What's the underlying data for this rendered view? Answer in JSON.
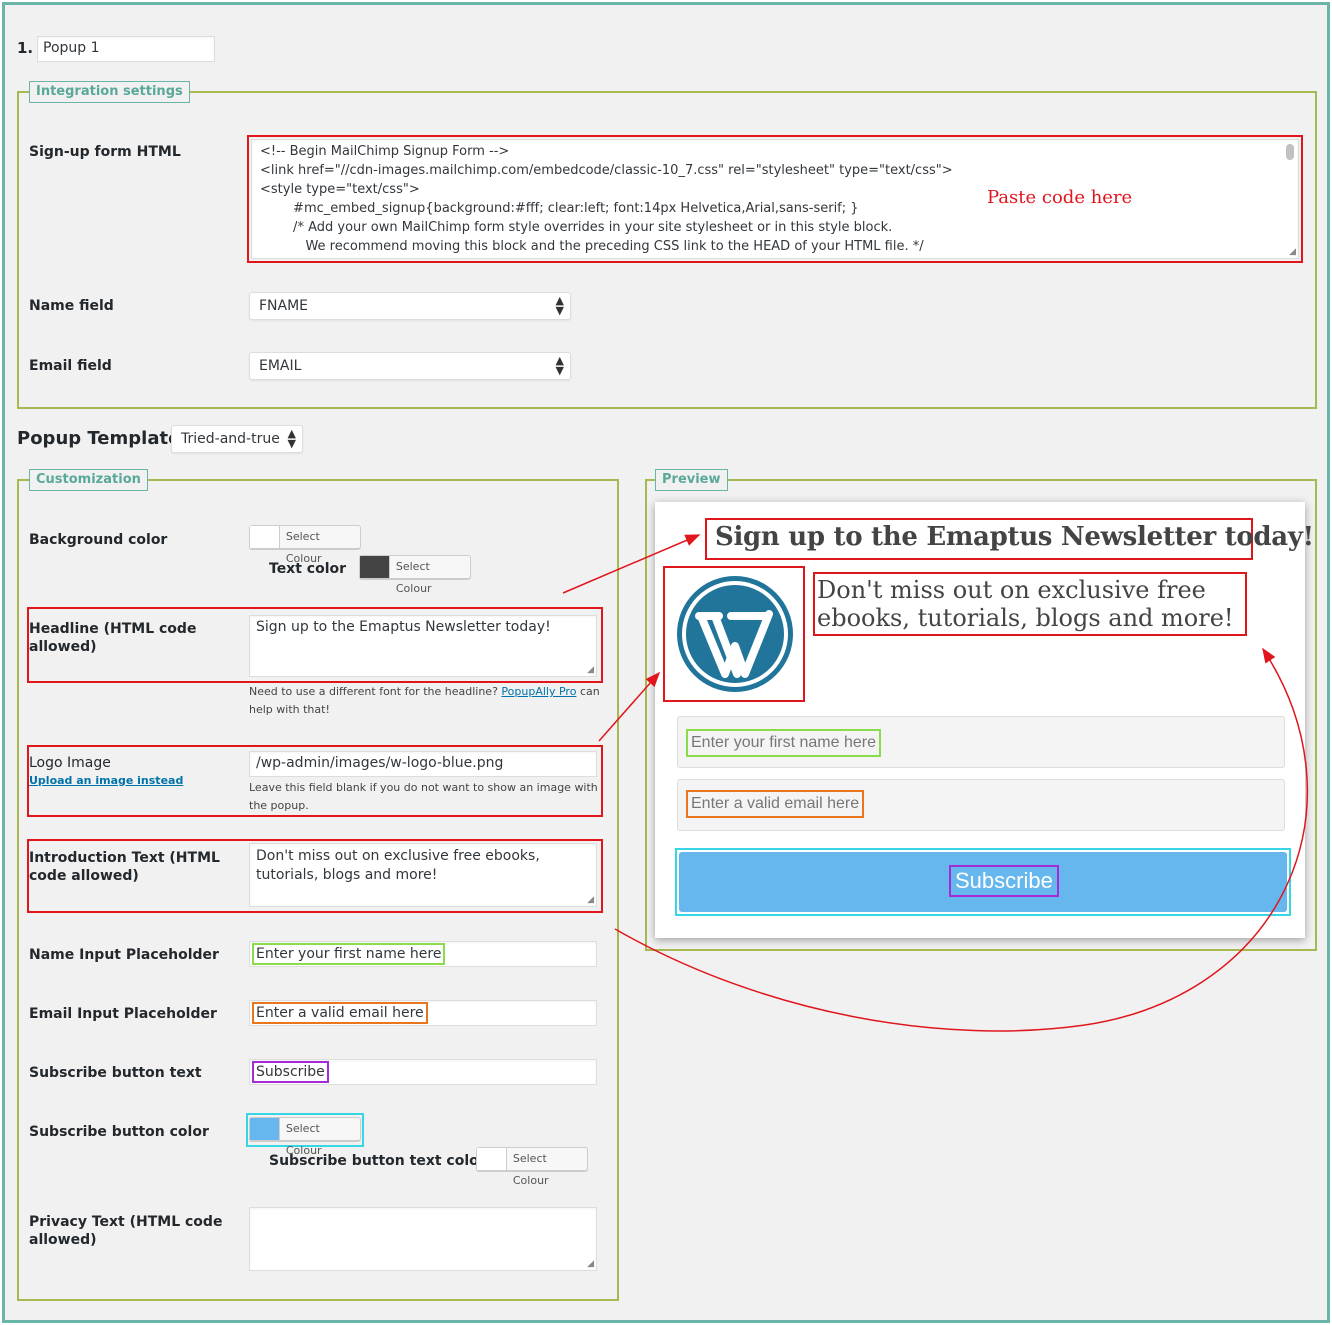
{
  "popup": {
    "number": "1.",
    "name": "Popup 1"
  },
  "integration": {
    "legend": "Integration settings",
    "signup_label": "Sign-up form HTML",
    "code_lines": [
      "<!-- Begin MailChimp Signup Form -->",
      "<link href=\"//cdn-images.mailchimp.com/embedcode/classic-10_7.css\" rel=\"stylesheet\" type=\"text/css\">",
      "<style type=\"text/css\">",
      "        #mc_embed_signup{background:#fff; clear:left; font:14px Helvetica,Arial,sans-serif; }",
      "        /* Add your own MailChimp form style overrides in your site stylesheet or in this style block.",
      "           We recommend moving this block and the preceding CSS link to the HEAD of your HTML file. */"
    ],
    "paste_note": "Paste code here",
    "name_label": "Name field",
    "name_value": "FNAME",
    "email_label": "Email field",
    "email_value": "EMAIL"
  },
  "template": {
    "label": "Popup Template",
    "value": "Tried-and-true"
  },
  "customization": {
    "legend": "Customization",
    "bg_label": "Background color",
    "select_colour": "Select Colour",
    "text_color_label": "Text color",
    "headline_label": "Headline (HTML code allowed)",
    "headline_value": "Sign up to the Emaptus Newsletter today!",
    "headline_help_pre": "Need to use a different font for the headline?",
    "headline_help_link": "PopupAlly Pro",
    "headline_help_post": "can help with that!",
    "logo_label": "Logo Image",
    "logo_upload": "Upload an image instead",
    "logo_value": "/wp-admin/images/w-logo-blue.png",
    "logo_help": "Leave this field blank if you do not want to show an image with the popup.",
    "intro_label": "Introduction Text (HTML code allowed)",
    "intro_value": "Don't miss out on exclusive free ebooks, tutorials, blogs and more!",
    "name_ph_label": "Name Input Placeholder",
    "name_ph_value": "Enter your first name here",
    "email_ph_label": "Email Input Placeholder",
    "email_ph_value": "Enter a valid email here",
    "btn_text_label": "Subscribe button text",
    "btn_text_value": "Subscribe",
    "btn_color_label": "Subscribe button color",
    "btn_text_color_label": "Subscribe button text color",
    "privacy_label": "Privacy Text (HTML code allowed)",
    "privacy_value": ""
  },
  "preview": {
    "legend": "Preview",
    "headline": "Sign up to the Emaptus Newsletter today!",
    "intro": "Don't miss out on exclusive free ebooks, tutorials, blogs and more!",
    "name_placeholder": "Enter your first name here",
    "email_placeholder": "Enter a valid email here",
    "button": "Subscribe"
  },
  "colors": {
    "button_color": "#65b7ee",
    "text_color": "#444444",
    "background_color": "#ffffff",
    "annotation_red": "#e0161d",
    "wp_blue": "#21759b"
  }
}
